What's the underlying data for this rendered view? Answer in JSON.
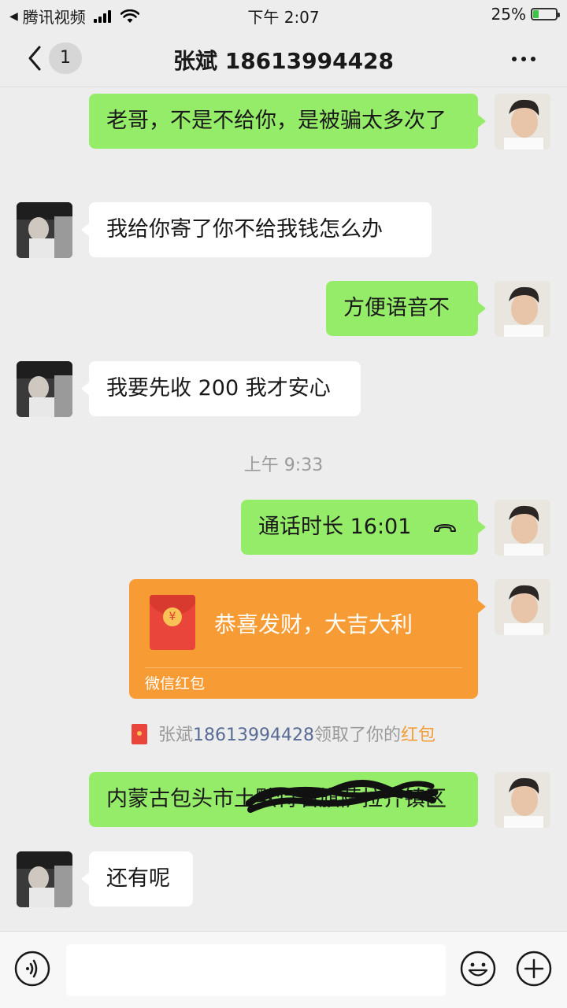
{
  "status_bar": {
    "back_app": "腾讯视频",
    "back_arrow": "◀",
    "time": "下午 2:07",
    "battery": "25%",
    "battery_level": 0.25,
    "battery_color": "#3cc447"
  },
  "nav": {
    "unread_count": "1",
    "title": "张斌 18613994428"
  },
  "messages": [
    {
      "side": "me",
      "text": "老哥，不是不给你，是被骗太多次了"
    },
    {
      "side": "other",
      "text": "我给你寄了你不给我钱怎么办"
    },
    {
      "side": "me",
      "text": "方便语音不"
    },
    {
      "side": "other",
      "text": "我要先收 200 我才安心"
    },
    {
      "side": "me",
      "text": "通话时长 16:01",
      "icon": "phone-hangup-icon"
    },
    {
      "side": "me",
      "text": "内蒙古包头市土默特右旗萨拉齐镇区"
    },
    {
      "side": "other",
      "text": "还有呢"
    }
  ],
  "timestamp": "上午 9:33",
  "red_packet": {
    "title": "恭喜发财，大吉大利",
    "footer": "微信红包",
    "coin": "¥",
    "color": "#f79c34"
  },
  "system_notice": {
    "name": "张斌",
    "phone": "18613994428",
    "middle": "领取了你的",
    "link": "红包"
  },
  "colors": {
    "bubble_me": "#95ec69",
    "bubble_other": "#ffffff",
    "background": "#ededed",
    "link": "#576b95"
  }
}
